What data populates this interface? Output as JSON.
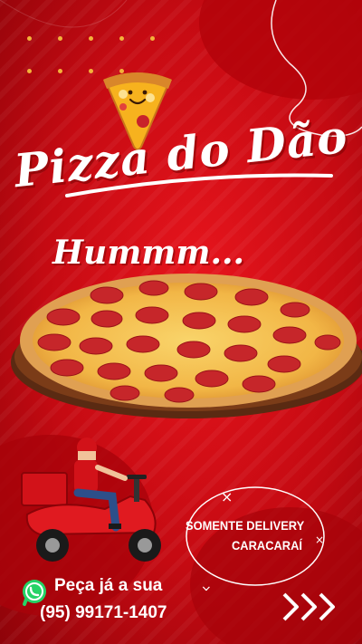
{
  "poster": {
    "title": "Pizza do Dão",
    "subtitle": "Hummm...",
    "badge": {
      "line1": "SOMENTE DELIVERY",
      "line2": "CARACARAÍ"
    },
    "cta": {
      "line1": "Peça já a sua",
      "phone": "(95) 99171-1407"
    },
    "icons": [
      "pizza-slice-mascot",
      "pizza",
      "delivery-scooter",
      "whatsapp",
      "chevron-right"
    ],
    "colors": {
      "background": "#d40d15",
      "text": "#ffffff",
      "accent": "#f3b23a",
      "whatsapp": "#25d366"
    }
  }
}
